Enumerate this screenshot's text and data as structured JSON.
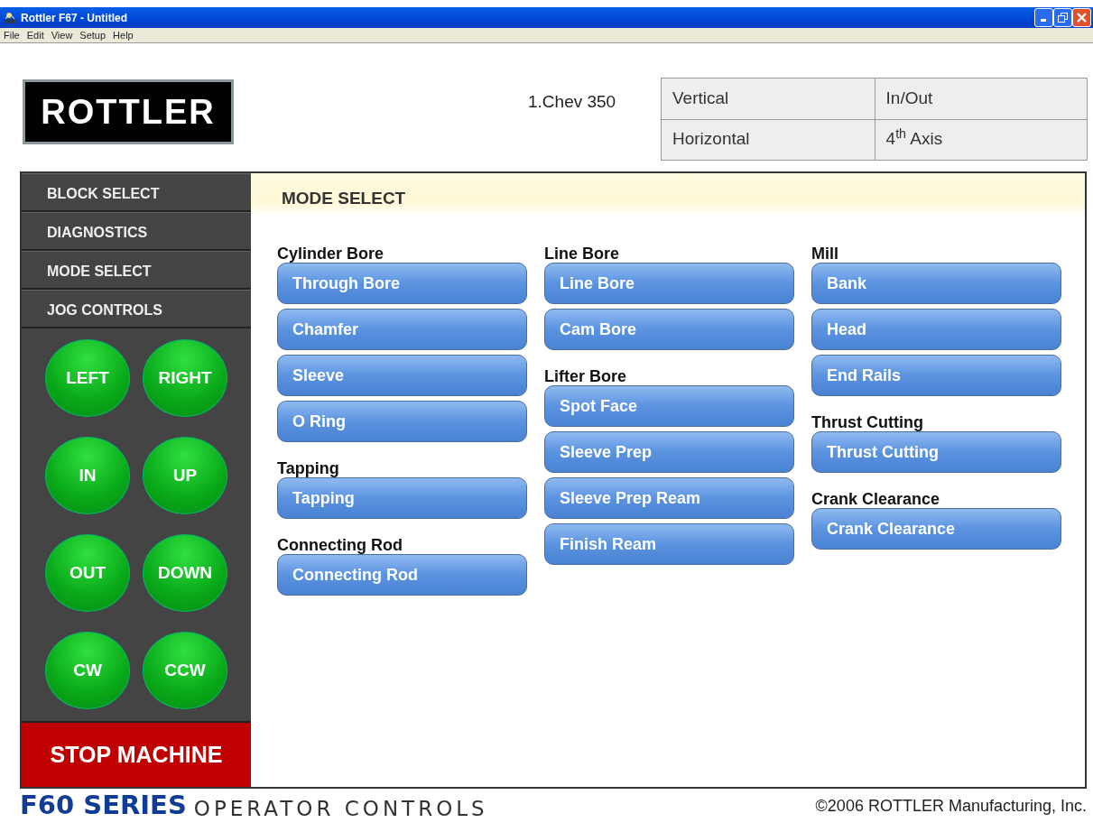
{
  "window": {
    "title": "Rottler F67 - Untitled"
  },
  "menu": [
    "File",
    "Edit",
    "View",
    "Setup",
    "Help"
  ],
  "logo": {
    "text": "ROTTLER"
  },
  "program": "1.Chev 350",
  "axes": [
    [
      "Vertical",
      "In/Out"
    ],
    [
      "Horizontal",
      "4$^{th}$ Axis"
    ]
  ],
  "sidebar": {
    "items": [
      "BLOCK SELECT",
      "DIAGNOSTICS",
      "MODE SELECT",
      "JOG CONTROLS"
    ],
    "jog_buttons": [
      "LEFT",
      "RIGHT",
      "IN",
      "UP",
      "OUT",
      "DOWN",
      "CW",
      "CCW"
    ],
    "stop_button": "STOP MACHINE"
  },
  "main": {
    "title": "MODE SELECT",
    "columns": [
      [
        {
          "heading": "Cylinder Bore",
          "buttons": [
            "Through Bore",
            "Chamfer",
            "Sleeve",
            "O Ring"
          ]
        },
        {
          "heading": "Tapping",
          "buttons": [
            "Tapping"
          ]
        },
        {
          "heading": "Connecting Rod",
          "buttons": [
            "Connecting Rod"
          ]
        }
      ],
      [
        {
          "heading": "Line Bore",
          "buttons": [
            "Line Bore",
            "Cam Bore"
          ]
        },
        {
          "heading": "Lifter Bore",
          "buttons": [
            "Spot Face",
            "Sleeve Prep",
            "Sleeve Prep Ream",
            "Finish Ream"
          ]
        }
      ],
      [
        {
          "heading": "Mill",
          "buttons": [
            "Bank",
            "Head",
            "End Rails"
          ]
        },
        {
          "heading": "Thrust Cutting",
          "buttons": [
            "Thrust Cutting"
          ]
        },
        {
          "heading": "Crank Clearance",
          "buttons": [
            "Crank Clearance"
          ]
        }
      ]
    ]
  },
  "footer": {
    "series": "F60 SERIES",
    "subtitle": "OPERATOR CONTROLS",
    "copyright": "©2006 ROTTLER Manufacturing, Inc."
  }
}
